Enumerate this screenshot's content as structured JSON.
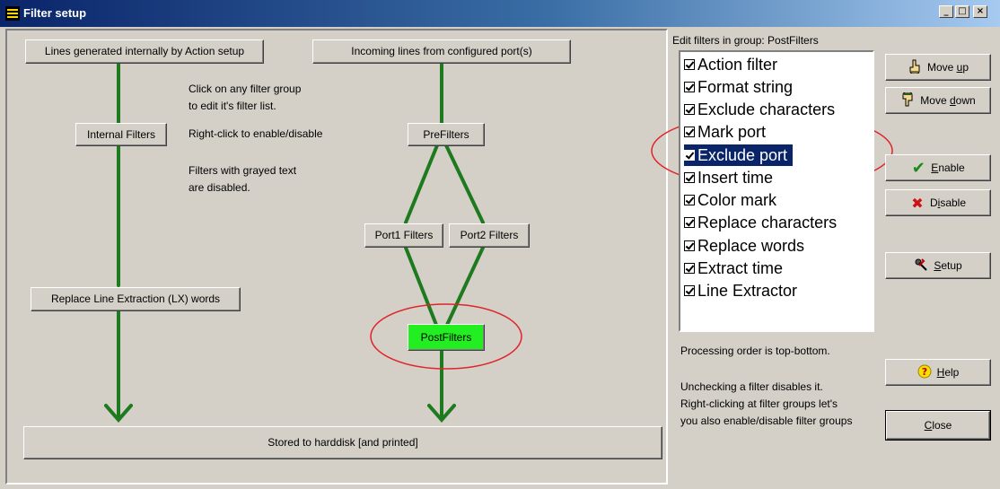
{
  "window": {
    "title": "Filter setup",
    "minimize": "_",
    "maximize": "□",
    "close": "×"
  },
  "diagram": {
    "internal_source": "Lines generated internally by Action setup",
    "incoming_source": "Incoming lines from configured port(s)",
    "internal_filters": "Internal Filters",
    "prefilters": "PreFilters",
    "port1_filters": "Port1 Filters",
    "port2_filters": "Port2 Filters",
    "replace_lx": "Replace Line Extraction (LX) words",
    "postfilters": "PostFilters",
    "stored": "Stored to harddisk [and printed]",
    "help_click_1": "Click on any filter group",
    "help_click_2": "to edit it's filter list.",
    "help_rightclick": "Right-click to enable/disable",
    "help_grayed_1": "Filters with grayed text",
    "help_grayed_2": "are disabled.",
    "colors": {
      "line": "#1e7a1e",
      "active_group": "#22ee22",
      "highlight_ellipse": "#e0242a"
    }
  },
  "filters_panel": {
    "label": "Edit filters in group: PostFilters",
    "items": [
      {
        "label": "Action filter",
        "checked": true
      },
      {
        "label": "Format string",
        "checked": true
      },
      {
        "label": "Exclude characters",
        "checked": true
      },
      {
        "label": "Mark port",
        "checked": true
      },
      {
        "label": "Exclude port",
        "checked": true
      },
      {
        "label": "Insert time",
        "checked": true
      },
      {
        "label": "Color mark",
        "checked": true
      },
      {
        "label": "Replace characters",
        "checked": true
      },
      {
        "label": "Replace words",
        "checked": true
      },
      {
        "label": "Extract time",
        "checked": true
      },
      {
        "label": "Line Extractor",
        "checked": true
      }
    ],
    "selected_item": "Exclude port",
    "processing_note": "Processing order is top-bottom.",
    "uncheck_note_1": "Unchecking a filter disables it.",
    "uncheck_note_2": "Right-clicking at filter groups let's",
    "uncheck_note_3": "you also enable/disable filter groups"
  },
  "buttons": {
    "move_up": {
      "pre": "Move ",
      "key": "u",
      "post": "p"
    },
    "move_down": {
      "pre": "Move ",
      "key": "d",
      "post": "own"
    },
    "enable": {
      "pre": "",
      "key": "E",
      "post": "nable"
    },
    "disable": {
      "pre": "D",
      "key": "i",
      "post": "sable"
    },
    "setup": {
      "pre": "",
      "key": "S",
      "post": "etup"
    },
    "help": {
      "pre": "",
      "key": "H",
      "post": "elp"
    },
    "close": {
      "pre": "",
      "key": "C",
      "post": "lose"
    }
  },
  "icons": {
    "move_up": "hand-pointing-up-icon",
    "move_down": "hand-pointing-down-icon",
    "enable": "green-checkmark-icon",
    "disable": "red-x-icon",
    "setup": "setup-tool-icon",
    "help": "help-question-icon"
  }
}
